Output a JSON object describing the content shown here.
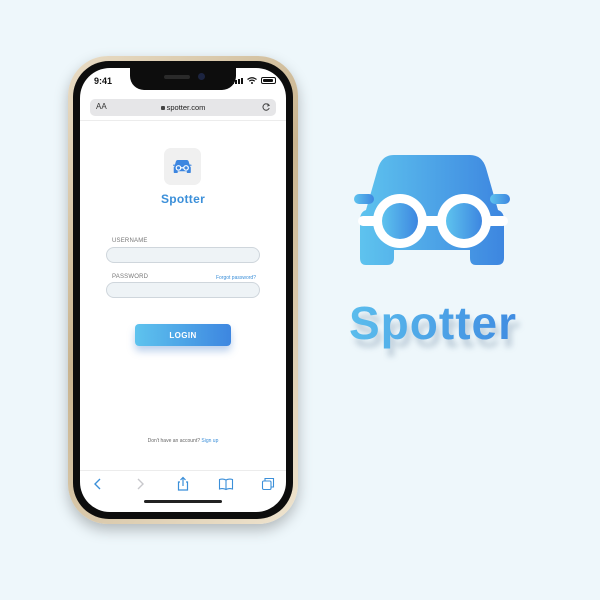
{
  "status_bar": {
    "time": "9:41"
  },
  "browser": {
    "text_size_label": "AA",
    "url": "spotter.com"
  },
  "app": {
    "name": "Spotter"
  },
  "form": {
    "username_label": "USERNAME",
    "username_value": "",
    "password_label": "PASSWORD",
    "password_value": "",
    "forgot_label": "Forgot password?",
    "login_label": "LOGIN"
  },
  "signup": {
    "prompt": "Don't have an account?",
    "link": "Sign up"
  },
  "toolbar": {
    "icons": [
      "back-icon",
      "forward-icon",
      "share-icon",
      "bookmarks-icon",
      "tabs-icon"
    ]
  },
  "brand": {
    "name": "Spotter"
  },
  "colors": {
    "accent_light": "#5ec3ee",
    "accent_dark": "#3d86e0",
    "background": "#eef7fb",
    "frame_gold": "#d8c7a6"
  }
}
